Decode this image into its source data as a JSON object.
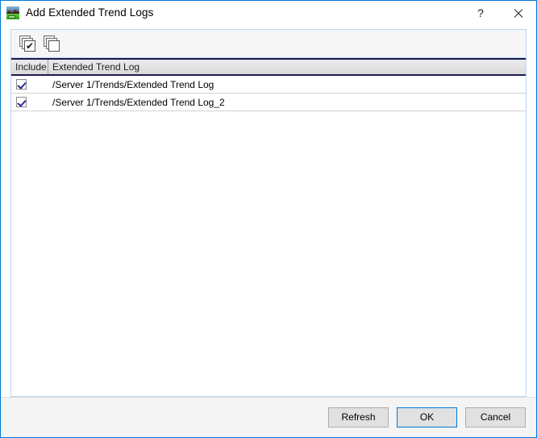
{
  "window": {
    "title": "Add Extended Trend Logs",
    "icon": "trend-log-app-icon",
    "help_label": "?",
    "close_label": "close-icon"
  },
  "toolbar": {
    "buttons": [
      {
        "name": "select-all-button",
        "icon": "stacked-pages-check-icon",
        "tick": "✔"
      },
      {
        "name": "clear-all-button",
        "icon": "stacked-pages-icon",
        "tick": ""
      }
    ]
  },
  "table": {
    "columns": [
      {
        "key": "include",
        "label": "Include"
      },
      {
        "key": "name",
        "label": "Extended Trend Log"
      }
    ],
    "rows": [
      {
        "include": true,
        "name": "/Server 1/Trends/Extended Trend Log"
      },
      {
        "include": true,
        "name": "/Server 1/Trends/Extended Trend Log_2"
      }
    ]
  },
  "footer": {
    "refresh_label": "Refresh",
    "ok_label": "OK",
    "cancel_label": "Cancel"
  },
  "colors": {
    "window_border": "#0078d7",
    "panel_border": "#bcd5f0",
    "header_rule": "#1b1b4f",
    "check": "#2c2c8f",
    "footer_bg": "#f4f4f4",
    "accent": "#0078d7"
  }
}
